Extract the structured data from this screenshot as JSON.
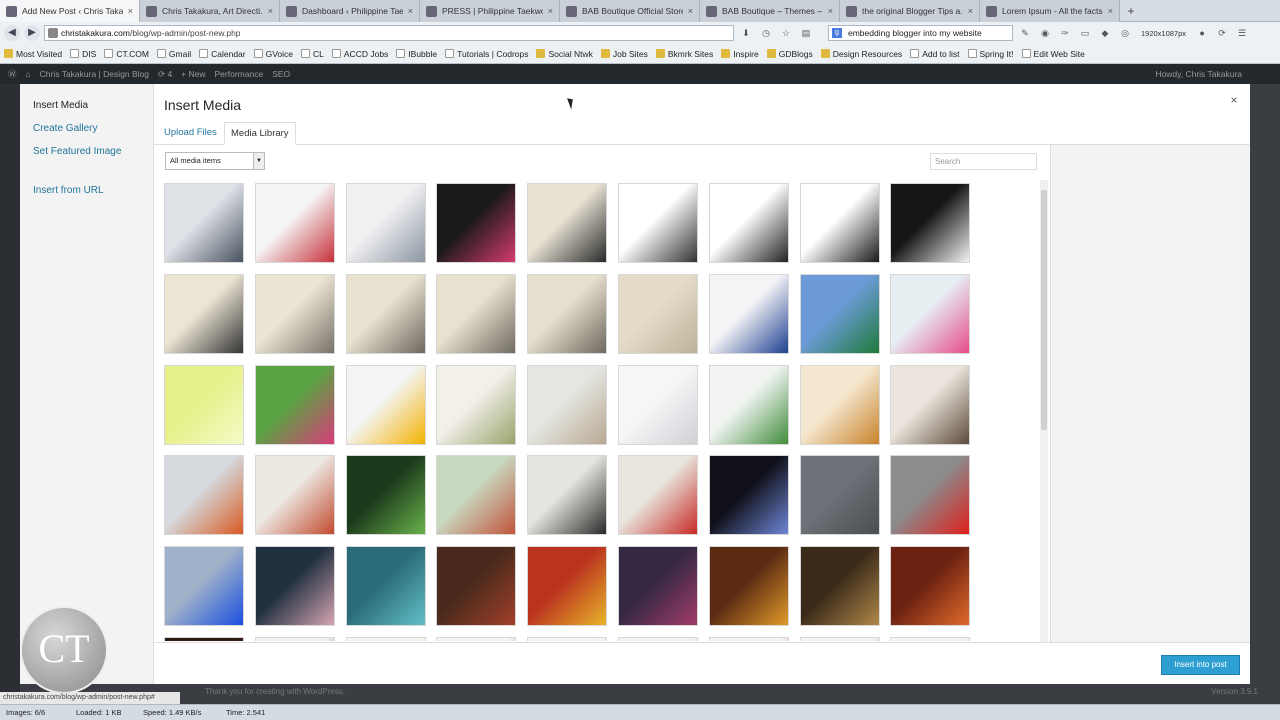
{
  "browser": {
    "tabs": [
      {
        "title": "Add New Post ‹ Chris Taka...",
        "active": true,
        "icon": "ct-favicon"
      },
      {
        "title": "Chris Takakura, Art Directi...",
        "active": false,
        "icon": "ct-favicon"
      },
      {
        "title": "Dashboard ‹ Philippine Taekwo...",
        "active": false,
        "icon": "wordpress-favicon"
      },
      {
        "title": "PRESS | Philippine Taekwo...",
        "active": false,
        "icon": "bird-favicon"
      },
      {
        "title": "BAB Boutique Official Store",
        "active": false,
        "icon": "gear-favicon"
      },
      {
        "title": "BAB Boutique – Themes – ...",
        "active": false,
        "icon": "wordpress-favicon"
      },
      {
        "title": "the original Blogger Tips a...",
        "active": false,
        "icon": "blogger-favicon"
      },
      {
        "title": "Lorem Ipsum - All the facts...",
        "active": false,
        "icon": "lorem-favicon"
      }
    ],
    "url_domain": "christakakura.com",
    "url_path": "/blog/wp-admin/post-new.php",
    "search_value": "embedding blogger into my website",
    "resolution": "1920x1087px",
    "bookmarks": [
      {
        "label": "Most Visited",
        "type": "folder"
      },
      {
        "label": "DIS",
        "type": "page"
      },
      {
        "label": "CT.COM",
        "type": "page"
      },
      {
        "label": "Gmail",
        "type": "page"
      },
      {
        "label": "Calendar",
        "type": "page"
      },
      {
        "label": "GVoice",
        "type": "page"
      },
      {
        "label": "CL",
        "type": "page"
      },
      {
        "label": "ACCD Jobs",
        "type": "page"
      },
      {
        "label": "IBubble",
        "type": "page"
      },
      {
        "label": "Tutorials | Codrops",
        "type": "page"
      },
      {
        "label": "Social Ntwk",
        "type": "folder"
      },
      {
        "label": "Job Sites",
        "type": "folder"
      },
      {
        "label": "Bkmrk Sites",
        "type": "folder"
      },
      {
        "label": "Inspire",
        "type": "folder"
      },
      {
        "label": "GDBlogs",
        "type": "folder"
      },
      {
        "label": "Design Resources",
        "type": "folder"
      },
      {
        "label": "Add to list",
        "type": "page"
      },
      {
        "label": "Spring It!",
        "type": "page"
      },
      {
        "label": "Edit Web Site",
        "type": "page"
      }
    ]
  },
  "adminbar": {
    "site_name": "Chris Takakura | Design Blog",
    "updates": "4",
    "new_label": "New",
    "performance_label": "Performance",
    "seo_label": "SEO",
    "howdy": "Howdy, Chris Takakura"
  },
  "modal": {
    "menu": [
      "Insert Media",
      "Create Gallery",
      "Set Featured Image",
      "Insert from URL"
    ],
    "title": "Insert Media",
    "tabs": [
      "Upload Files",
      "Media Library"
    ],
    "active_tab": "Media Library",
    "filter_value": "All media items",
    "search_placeholder": "Search",
    "insert_button": "Insert into post",
    "close_glyph": "×",
    "thumbnails": [
      [
        "#dfe3e8",
        "#4a5260"
      ],
      [
        "#f4f4f4",
        "#c8313a"
      ],
      [
        "#f0f0f2",
        "#8c96a2"
      ],
      [
        "#1a1a1a",
        "#d63b6e"
      ],
      [
        "#e8e2d4",
        "#2a2a2a"
      ],
      [
        "#ffffff",
        "#333333"
      ],
      [
        "#ffffff",
        "#222222"
      ],
      [
        "#ffffff",
        "#1a1a1a"
      ],
      [
        "#161616",
        "#f2f2f2"
      ],
      [
        "#ece5d4",
        "#333333"
      ],
      [
        "#ebe4d2",
        "#77716a"
      ],
      [
        "#e9e2d0",
        "#6c665e"
      ],
      [
        "#e8e1cf",
        "#6f6a61"
      ],
      [
        "#e6dfcd",
        "#6e685f"
      ],
      [
        "#e5dcc8",
        "#bdb19a"
      ],
      [
        "#f4f4f6",
        "#1d3f8f"
      ],
      [
        "#6c9bd8",
        "#1f7a3a"
      ],
      [
        "#e6eef2",
        "#e64c8a"
      ],
      [
        "#e6f08a",
        "#f6fbc9"
      ],
      [
        "#5aa342",
        "#d83c7a"
      ],
      [
        "#f4f4f4",
        "#f2b200"
      ],
      [
        "#f3f0ea",
        "#9aa46a"
      ],
      [
        "#e4e6e2",
        "#b8a892"
      ],
      [
        "#f6f6f8",
        "#cfd1d4"
      ],
      [
        "#f0f3f0",
        "#3f8c3a"
      ],
      [
        "#f5e8d0",
        "#c8822a"
      ],
      [
        "#eae4dc",
        "#5b4a3a"
      ],
      [
        "#d6dadf",
        "#d85a23"
      ],
      [
        "#ece8e2",
        "#c24a2e"
      ],
      [
        "#1c3a1c",
        "#69b24a"
      ],
      [
        "#c9d8c0",
        "#c0543a"
      ],
      [
        "#e3e6de",
        "#2c2a2a"
      ],
      [
        "#e8e4de",
        "#c82a24"
      ],
      [
        "#101018",
        "#6e86d8"
      ],
      [
        "#6e7278",
        "#4a4e52"
      ],
      [
        "#8a8c8e",
        "#e0201a"
      ],
      [
        "#9fb2c9",
        "#1c4fe0"
      ],
      [
        "#223140",
        "#d6a6b4"
      ],
      [
        "#2b6b78",
        "#62c0c8"
      ],
      [
        "#4a2a1c",
        "#a2402a"
      ],
      [
        "#b9331e",
        "#e8b42a"
      ],
      [
        "#342844",
        "#a23c6a"
      ],
      [
        "#5a2a12",
        "#e09a2a"
      ],
      [
        "#3a2a1a",
        "#b08848"
      ],
      [
        "#6c2212",
        "#e06a2a"
      ],
      [
        "#2a1a12",
        "#b03a2a"
      ],
      [
        "#f0f0ee",
        "#222222"
      ],
      [
        "#f6f4ee",
        "#d8c8a8"
      ],
      [
        "#f4f6f4",
        "#3a7a3a"
      ],
      [
        "#f6f6f2",
        "#c8c0a8"
      ],
      [
        "#f2f2f2",
        "#9aa4b2"
      ],
      [
        "#f6f4f2",
        "#c82a2a"
      ],
      [
        "#f4f4f4",
        "#888888"
      ],
      [
        "#f4f4f4",
        "#a8a8a8"
      ]
    ]
  },
  "footer": {
    "proudly": "Thank you for creating with WordPress.",
    "version": "Version 3.9.1"
  },
  "status": {
    "hover_url": "christakakura.com/blog/wp-admin/post-new.php#",
    "images": "Images: 6/6",
    "loaded": "Loaded: 1 KB",
    "speed": "Speed: 1.49 KB/s",
    "time": "Time: 2.541"
  },
  "logo_text": "CT"
}
